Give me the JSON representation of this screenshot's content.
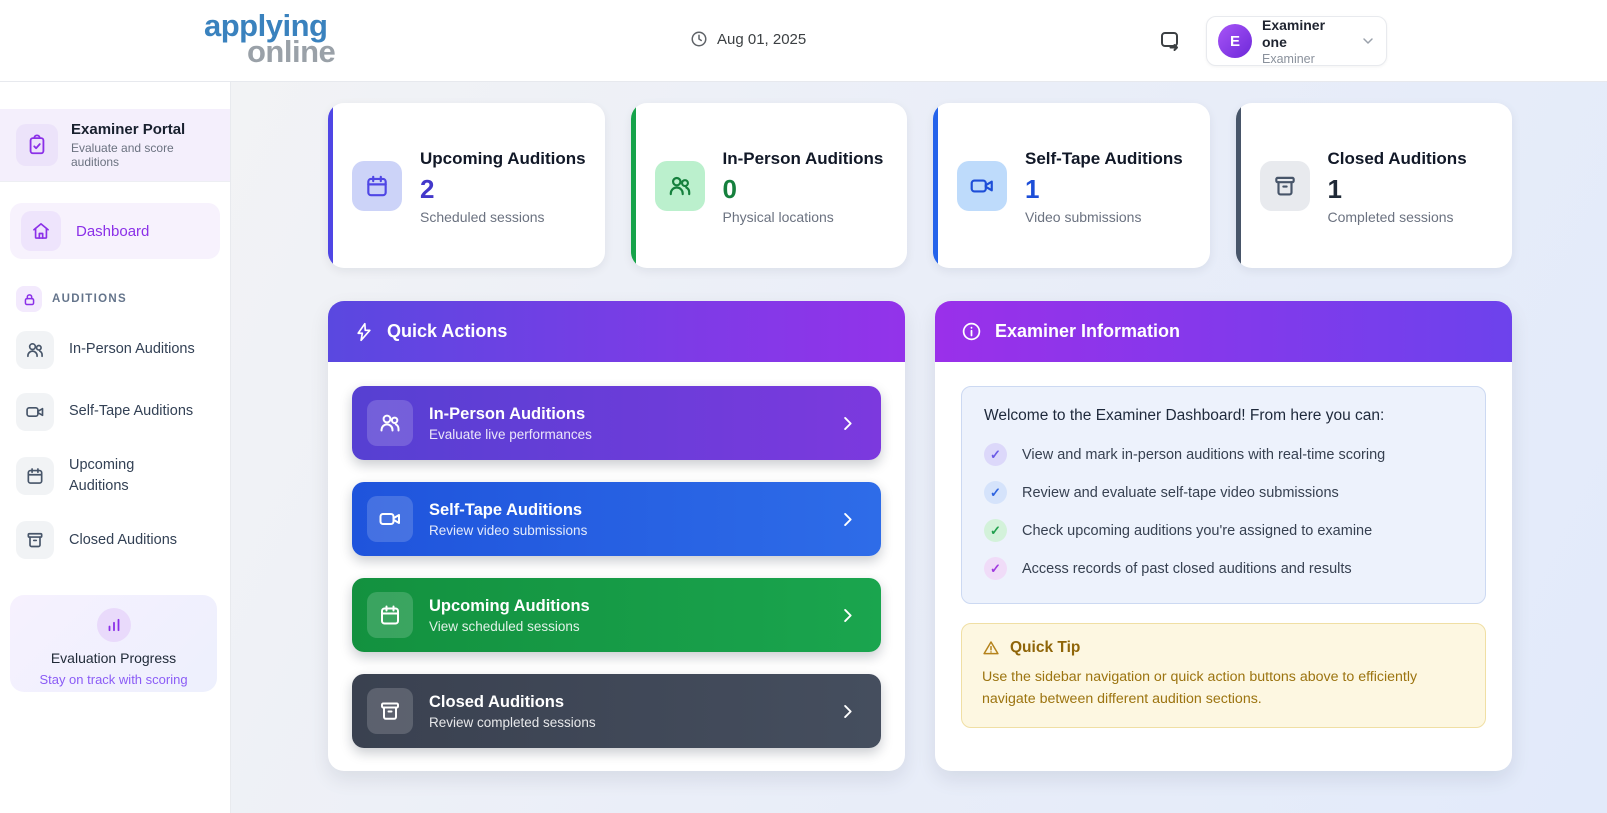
{
  "header": {
    "logo_line1": "applying",
    "logo_line2": "online",
    "date": "Aug 01, 2025",
    "user": {
      "initial": "E",
      "name": "Examiner one",
      "role": "Examiner"
    }
  },
  "sidebar": {
    "portal": {
      "title": "Examiner Portal",
      "subtitle": "Evaluate and score auditions"
    },
    "dashboard_label": "Dashboard",
    "section_label": "AUDITIONS",
    "items": [
      {
        "label": "In-Person Auditions"
      },
      {
        "label": "Self-Tape Auditions"
      },
      {
        "label": "Upcoming Auditions"
      },
      {
        "label": "Closed Auditions"
      }
    ],
    "progress": {
      "title": "Evaluation Progress",
      "subtitle": "Stay on track with scoring"
    }
  },
  "stats": [
    {
      "title": "Upcoming Auditions",
      "value": "2",
      "subtitle": "Scheduled sessions",
      "accent": "#4f46e5"
    },
    {
      "title": "In-Person Auditions",
      "value": "0",
      "subtitle": "Physical locations",
      "accent": "#16a34a"
    },
    {
      "title": "Self-Tape Auditions",
      "value": "1",
      "subtitle": "Video submissions",
      "accent": "#2563eb"
    },
    {
      "title": "Closed Auditions",
      "value": "1",
      "subtitle": "Completed sessions",
      "accent": "#475569"
    }
  ],
  "quick_actions": {
    "title": "Quick Actions",
    "actions": [
      {
        "title": "In-Person Auditions",
        "subtitle": "Evaluate live performances"
      },
      {
        "title": "Self-Tape Auditions",
        "subtitle": "Review video submissions"
      },
      {
        "title": "Upcoming Auditions",
        "subtitle": "View scheduled sessions"
      },
      {
        "title": "Closed Auditions",
        "subtitle": "Review completed sessions"
      }
    ]
  },
  "examiner_info": {
    "title": "Examiner Information",
    "welcome_title": "Welcome to the Examiner Dashboard! From here you can:",
    "check_mark": "✓",
    "items": [
      {
        "text": "View and mark in-person auditions with real-time scoring"
      },
      {
        "text": "Review and evaluate self-tape video submissions"
      },
      {
        "text": "Check upcoming auditions you're assigned to examine"
      },
      {
        "text": "Access records of past closed auditions and results"
      }
    ],
    "tip_title": "Quick Tip",
    "tip_text": "Use the sidebar navigation or quick action buttons above to efficiently navigate between different audition sections."
  },
  "colors": {
    "brand_blue": "#3a82be",
    "brand_gray": "#9aa1a8",
    "purple_accent": "#8b30e8",
    "qa_gradient": [
      "#5a48e0",
      "#9333ea"
    ],
    "info_gradient": [
      "#9a30ea",
      "#6d42ec"
    ],
    "stat_accents": [
      "#4f46e5",
      "#16a34a",
      "#2563eb",
      "#475569"
    ]
  }
}
